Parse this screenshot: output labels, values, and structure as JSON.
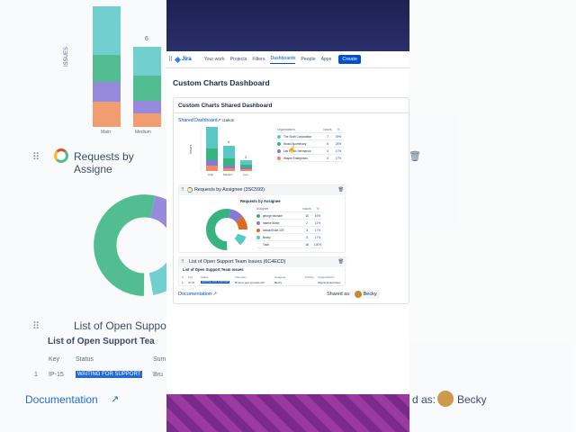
{
  "background": {
    "left": {
      "bar_value_label": "6",
      "yaxis_label": "ISSUES",
      "x_labels": [
        "Main",
        "Medium"
      ],
      "gadget_title": "Requests by Assigne",
      "list_title": "List of Open Suppo",
      "list_subtitle": "List of Open Support Tea",
      "col_key": "Key",
      "col_status": "Status",
      "col_summary": "Sum",
      "row_num": "1",
      "row_key": "IP-15",
      "row_status": "WAITING FOR SUPPORT",
      "row_summary": "Bru",
      "documentation": "Documentation"
    },
    "right": {
      "shared_label": "d as:",
      "user": "Becky"
    }
  },
  "nav": {
    "logo": "Jira",
    "items": [
      "Your work",
      "Projects",
      "Filters",
      "Dashboards",
      "People",
      "Apps"
    ],
    "active_index": 3,
    "create": "Create"
  },
  "page": {
    "title": "Custom Charts Dashboard",
    "panel_title": "Custom Charts Shared Dashboard",
    "shared_link": "Shared Dashboard",
    "shared_suffix": "ization"
  },
  "gadget1": {
    "chart_title": "",
    "legend_header": [
      "Organizations",
      "Issues",
      "%"
    ],
    "rows": [
      {
        "name": "The Sloth Corporation",
        "issues": "7",
        "pct": "39%",
        "color": "#5bc8c8"
      },
      {
        "name": "Woski Apothecary",
        "issues": "5",
        "pct": "28%",
        "color": "#36b37e"
      },
      {
        "name": "Las Pollos Hermanos",
        "issues": "3",
        "pct": "17%",
        "color": "#8777d9"
      },
      {
        "name": "Wayne Enterprises",
        "issues": "3",
        "pct": "17%",
        "color": "#f28c5a"
      }
    ],
    "bar_labels": [
      "6",
      "3"
    ],
    "x_labels": [
      "High",
      "Medium",
      "Low"
    ],
    "yaxis": "Issues"
  },
  "gadget2": {
    "title": "Requests by Assignee (3SC599)",
    "chart_title": "Requests by Assignee",
    "legend_header": [
      "Assignee",
      "Issues",
      "%"
    ],
    "rows": [
      {
        "name": "george.michael",
        "issues": "10",
        "pct": "53%",
        "color": "#36b37e"
      },
      {
        "name": "maebe.fünke",
        "issues": "2",
        "pct": "11%",
        "color": "#8777d9"
      },
      {
        "name": "tobias.fünke.123",
        "issues": "3",
        "pct": "17%",
        "color": "#de6a1f"
      },
      {
        "name": "Becky",
        "issues": "3",
        "pct": "17%",
        "color": "#5bc8c8"
      },
      {
        "name": "Total",
        "issues": "18",
        "pct": "100%",
        "color": ""
      }
    ]
  },
  "gadget3": {
    "title": "List of Open Support Team Issues (6C4ECD)",
    "subtitle": "List of Open Support Team Issues",
    "headers": [
      "#",
      "Key",
      "Status",
      "Summary",
      "Assignee",
      "Priority",
      "Organizations"
    ],
    "row": [
      "1",
      "IP-15",
      "WAITING FOR SUPPORT",
      "Bruce's new gt seats will",
      "Becky",
      "",
      "Wayne Enterprises"
    ]
  },
  "footer": {
    "documentation": "Documentation",
    "shared_as": "Shared as:",
    "user": "Becky"
  }
}
